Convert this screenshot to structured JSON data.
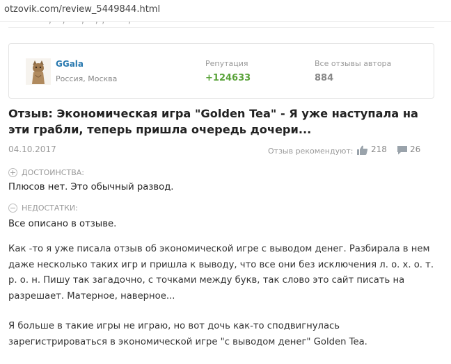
{
  "browser": {
    "url": "otzovik.com/review_5449844.html"
  },
  "author": {
    "name": "GGala",
    "location": "Россия, Москва",
    "reputation_label": "Репутация",
    "reputation_value": "+124633",
    "all_reviews_label": "Все отзывы автора",
    "all_reviews_value": "884"
  },
  "review": {
    "title": "Отзыв: Экономическая игра \"Golden Tea\" - Я уже наступала на эти грабли, теперь пришла очередь дочери...",
    "date": "04.10.2017",
    "recommend_label": "Отзыв рекомендуют:",
    "likes": "218",
    "comments": "26",
    "pros_label": "ДОСТОИНСТВА:",
    "pros_text": "Плюсов нет. Это обычный развод.",
    "cons_label": "НЕДОСТАТКИ:",
    "cons_text": "Все описано в отзыве.",
    "paragraphs": [
      "Как -то я уже писала отзыв об экономической игре с выводом денег. Разбирала в нем даже несколько таких игр и пришла к выводу, что все они без исключения л. о. х. о. т. р. о. н. Пишу так загадочно, с точками между букв, так слово это сайт писать на разрешает. Матерное, наверное...",
      "Я больше в такие игры не играю, но вот дочь как-то сподвигнулась зарегистрироваться в экономической игре \"с выводом денег\" Golden Tea."
    ]
  },
  "icons": {
    "plus": "plus-circle-icon",
    "minus": "minus-circle-icon",
    "like": "thumbs-up-icon",
    "comment": "comment-icon"
  },
  "colors": {
    "link": "#2a7ab0",
    "reputation": "#5aa33a",
    "muted": "#999999"
  }
}
